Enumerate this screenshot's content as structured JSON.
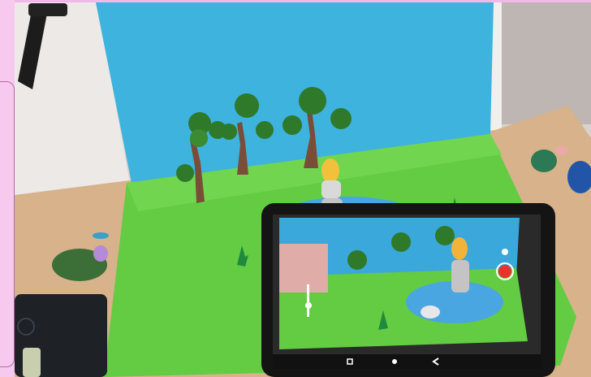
{
  "scene": {
    "subject": "clay-stop-motion-set",
    "tablet_app": {
      "icons": [
        "record-icon",
        "settings-icon",
        "zoom-slider-icon",
        "home-icon",
        "back-icon",
        "recent-apps-icon"
      ],
      "record_color": "#e8322c"
    },
    "colors": {
      "sky_backdrop": "#3fb4de",
      "grass_mat": "#67cf45",
      "pond": "#4aa4de",
      "table": "#d9b48a",
      "wall": "#e9e6e4",
      "frame": "#f4c6ec"
    }
  }
}
